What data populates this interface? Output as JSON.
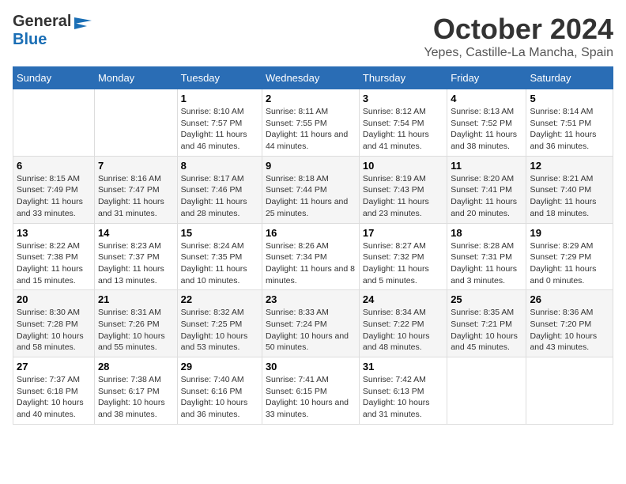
{
  "header": {
    "logo_general": "General",
    "logo_blue": "Blue",
    "month": "October 2024",
    "location": "Yepes, Castille-La Mancha, Spain"
  },
  "days_of_week": [
    "Sunday",
    "Monday",
    "Tuesday",
    "Wednesday",
    "Thursday",
    "Friday",
    "Saturday"
  ],
  "weeks": [
    [
      {
        "day": "",
        "info": ""
      },
      {
        "day": "",
        "info": ""
      },
      {
        "day": "1",
        "info": "Sunrise: 8:10 AM\nSunset: 7:57 PM\nDaylight: 11 hours and 46 minutes."
      },
      {
        "day": "2",
        "info": "Sunrise: 8:11 AM\nSunset: 7:55 PM\nDaylight: 11 hours and 44 minutes."
      },
      {
        "day": "3",
        "info": "Sunrise: 8:12 AM\nSunset: 7:54 PM\nDaylight: 11 hours and 41 minutes."
      },
      {
        "day": "4",
        "info": "Sunrise: 8:13 AM\nSunset: 7:52 PM\nDaylight: 11 hours and 38 minutes."
      },
      {
        "day": "5",
        "info": "Sunrise: 8:14 AM\nSunset: 7:51 PM\nDaylight: 11 hours and 36 minutes."
      }
    ],
    [
      {
        "day": "6",
        "info": "Sunrise: 8:15 AM\nSunset: 7:49 PM\nDaylight: 11 hours and 33 minutes."
      },
      {
        "day": "7",
        "info": "Sunrise: 8:16 AM\nSunset: 7:47 PM\nDaylight: 11 hours and 31 minutes."
      },
      {
        "day": "8",
        "info": "Sunrise: 8:17 AM\nSunset: 7:46 PM\nDaylight: 11 hours and 28 minutes."
      },
      {
        "day": "9",
        "info": "Sunrise: 8:18 AM\nSunset: 7:44 PM\nDaylight: 11 hours and 25 minutes."
      },
      {
        "day": "10",
        "info": "Sunrise: 8:19 AM\nSunset: 7:43 PM\nDaylight: 11 hours and 23 minutes."
      },
      {
        "day": "11",
        "info": "Sunrise: 8:20 AM\nSunset: 7:41 PM\nDaylight: 11 hours and 20 minutes."
      },
      {
        "day": "12",
        "info": "Sunrise: 8:21 AM\nSunset: 7:40 PM\nDaylight: 11 hours and 18 minutes."
      }
    ],
    [
      {
        "day": "13",
        "info": "Sunrise: 8:22 AM\nSunset: 7:38 PM\nDaylight: 11 hours and 15 minutes."
      },
      {
        "day": "14",
        "info": "Sunrise: 8:23 AM\nSunset: 7:37 PM\nDaylight: 11 hours and 13 minutes."
      },
      {
        "day": "15",
        "info": "Sunrise: 8:24 AM\nSunset: 7:35 PM\nDaylight: 11 hours and 10 minutes."
      },
      {
        "day": "16",
        "info": "Sunrise: 8:26 AM\nSunset: 7:34 PM\nDaylight: 11 hours and 8 minutes."
      },
      {
        "day": "17",
        "info": "Sunrise: 8:27 AM\nSunset: 7:32 PM\nDaylight: 11 hours and 5 minutes."
      },
      {
        "day": "18",
        "info": "Sunrise: 8:28 AM\nSunset: 7:31 PM\nDaylight: 11 hours and 3 minutes."
      },
      {
        "day": "19",
        "info": "Sunrise: 8:29 AM\nSunset: 7:29 PM\nDaylight: 11 hours and 0 minutes."
      }
    ],
    [
      {
        "day": "20",
        "info": "Sunrise: 8:30 AM\nSunset: 7:28 PM\nDaylight: 10 hours and 58 minutes."
      },
      {
        "day": "21",
        "info": "Sunrise: 8:31 AM\nSunset: 7:26 PM\nDaylight: 10 hours and 55 minutes."
      },
      {
        "day": "22",
        "info": "Sunrise: 8:32 AM\nSunset: 7:25 PM\nDaylight: 10 hours and 53 minutes."
      },
      {
        "day": "23",
        "info": "Sunrise: 8:33 AM\nSunset: 7:24 PM\nDaylight: 10 hours and 50 minutes."
      },
      {
        "day": "24",
        "info": "Sunrise: 8:34 AM\nSunset: 7:22 PM\nDaylight: 10 hours and 48 minutes."
      },
      {
        "day": "25",
        "info": "Sunrise: 8:35 AM\nSunset: 7:21 PM\nDaylight: 10 hours and 45 minutes."
      },
      {
        "day": "26",
        "info": "Sunrise: 8:36 AM\nSunset: 7:20 PM\nDaylight: 10 hours and 43 minutes."
      }
    ],
    [
      {
        "day": "27",
        "info": "Sunrise: 7:37 AM\nSunset: 6:18 PM\nDaylight: 10 hours and 40 minutes."
      },
      {
        "day": "28",
        "info": "Sunrise: 7:38 AM\nSunset: 6:17 PM\nDaylight: 10 hours and 38 minutes."
      },
      {
        "day": "29",
        "info": "Sunrise: 7:40 AM\nSunset: 6:16 PM\nDaylight: 10 hours and 36 minutes."
      },
      {
        "day": "30",
        "info": "Sunrise: 7:41 AM\nSunset: 6:15 PM\nDaylight: 10 hours and 33 minutes."
      },
      {
        "day": "31",
        "info": "Sunrise: 7:42 AM\nSunset: 6:13 PM\nDaylight: 10 hours and 31 minutes."
      },
      {
        "day": "",
        "info": ""
      },
      {
        "day": "",
        "info": ""
      }
    ]
  ]
}
